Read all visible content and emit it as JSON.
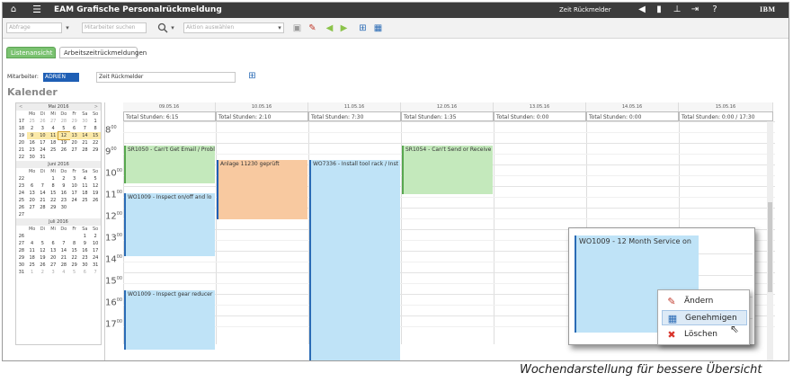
{
  "topbar": {
    "app_title": "EAM Grafische Personalrückmeldung",
    "user_label": "Zeit Rückmelder",
    "brand": "IBM",
    "icons": [
      "home-icon",
      "menu-icon",
      "flag-icon",
      "chart-icon",
      "person-icon",
      "logout-icon",
      "help-icon"
    ]
  },
  "toolbar": {
    "field1_value": "Abfrage",
    "search_placeholder": "Mitarbeiter suchen",
    "action_placeholder": "Aktion auswählen",
    "icons": [
      "search-icon",
      "save-icon",
      "edit-icon",
      "back-icon",
      "forward-icon",
      "report-icon",
      "calendar-icon"
    ]
  },
  "tabs": [
    {
      "label": "Listenansicht",
      "active": true
    },
    {
      "label": "Arbeitszeitrückmeldungen",
      "active": false
    }
  ],
  "form": {
    "mitarbeiter_label": "Mitarbeiter:",
    "mitarbeiter_value": "ADRIEN",
    "name_value": "Zeit Rückmelder"
  },
  "heading": "Kalender",
  "minicals": [
    {
      "title": "Mai 2016",
      "prev": "<",
      "next": ">",
      "dow": [
        "Mo",
        "Di",
        "Mi",
        "Do",
        "Fr",
        "Sa",
        "So"
      ],
      "rows": [
        [
          "17",
          "25",
          "26",
          "27",
          "28",
          "29",
          "30",
          "1"
        ],
        [
          "18",
          "2",
          "3",
          "4",
          "5",
          "6",
          "7",
          "8"
        ],
        [
          "19",
          "9",
          "10",
          "11",
          "12",
          "13",
          "14",
          "15"
        ],
        [
          "20",
          "16",
          "17",
          "18",
          "19",
          "20",
          "21",
          "22"
        ],
        [
          "21",
          "23",
          "24",
          "25",
          "26",
          "27",
          "28",
          "29"
        ],
        [
          "22",
          "30",
          "31",
          "",
          "",
          "",
          "",
          ""
        ]
      ]
    },
    {
      "title": "Juni 2016",
      "dow": [
        "Mo",
        "Di",
        "Mi",
        "Do",
        "Fr",
        "Sa",
        "So"
      ],
      "rows": [
        [
          "22",
          "",
          "",
          "1",
          "2",
          "3",
          "4",
          "5"
        ],
        [
          "23",
          "6",
          "7",
          "8",
          "9",
          "10",
          "11",
          "12"
        ],
        [
          "24",
          "13",
          "14",
          "15",
          "16",
          "17",
          "18",
          "19"
        ],
        [
          "25",
          "20",
          "21",
          "22",
          "23",
          "24",
          "25",
          "26"
        ],
        [
          "26",
          "27",
          "28",
          "29",
          "30",
          "",
          "",
          " "
        ],
        [
          "27",
          "",
          "",
          "",
          "",
          "",
          "",
          ""
        ]
      ]
    },
    {
      "title": "Juli 2016",
      "dow": [
        "Mo",
        "Di",
        "Mi",
        "Do",
        "Fr",
        "Sa",
        "So"
      ],
      "rows": [
        [
          "26",
          "",
          "",
          "",
          "",
          "",
          "1",
          "2",
          "3"
        ],
        [
          "27",
          "4",
          "5",
          "6",
          "7",
          "8",
          "9",
          "10"
        ],
        [
          "28",
          "11",
          "12",
          "13",
          "14",
          "15",
          "16",
          "17"
        ],
        [
          "29",
          "18",
          "19",
          "20",
          "21",
          "22",
          "23",
          "24"
        ],
        [
          "30",
          "25",
          "26",
          "27",
          "28",
          "29",
          "30",
          "31"
        ],
        [
          "31",
          "1",
          "2",
          "3",
          "4",
          "5",
          "6",
          "7"
        ]
      ]
    }
  ],
  "days": [
    {
      "date": "09.05.16",
      "total": "Total Stunden: 6:15"
    },
    {
      "date": "10.05.16",
      "total": "Total Stunden: 2:10"
    },
    {
      "date": "11.05.16",
      "total": "Total Stunden: 7:30"
    },
    {
      "date": "12.05.16",
      "total": "Total Stunden: 1:35"
    },
    {
      "date": "13.05.16",
      "total": "Total Stunden: 0:00"
    },
    {
      "date": "14.05.16",
      "total": "Total Stunden: 0:00"
    },
    {
      "date": "15.05.16",
      "total": "Total Stunden: 0:00 / 17:30"
    }
  ],
  "hours": [
    "8",
    "9",
    "10",
    "11",
    "12",
    "13",
    "14",
    "15",
    "16",
    "17"
  ],
  "hour_suffix": "00",
  "events": [
    {
      "label": "SR1050 - Can't Get Email / Probl",
      "color": "green"
    },
    {
      "label": "Anlage 11230 geprüft",
      "color": "orange"
    },
    {
      "label": "WO7336 - Install tool rack / Inst",
      "color": "blue"
    },
    {
      "label": "SR1054 - Can't Send or Receive",
      "color": "green"
    },
    {
      "label": "WO1009 - Inspect on/off and lo",
      "color": "blue"
    },
    {
      "label": "WO1009 - Inspect gear reducer",
      "color": "blue"
    }
  ],
  "popup_event": "WO1009 - 12 Month Service on",
  "context_menu": [
    {
      "label": "Ändern",
      "icon": "edit-icon"
    },
    {
      "label": "Genehmigen",
      "icon": "approve-icon",
      "selected": true
    },
    {
      "label": "Löschen",
      "icon": "delete-icon"
    }
  ],
  "caption": "Wochendarstellung für bessere Übersicht"
}
